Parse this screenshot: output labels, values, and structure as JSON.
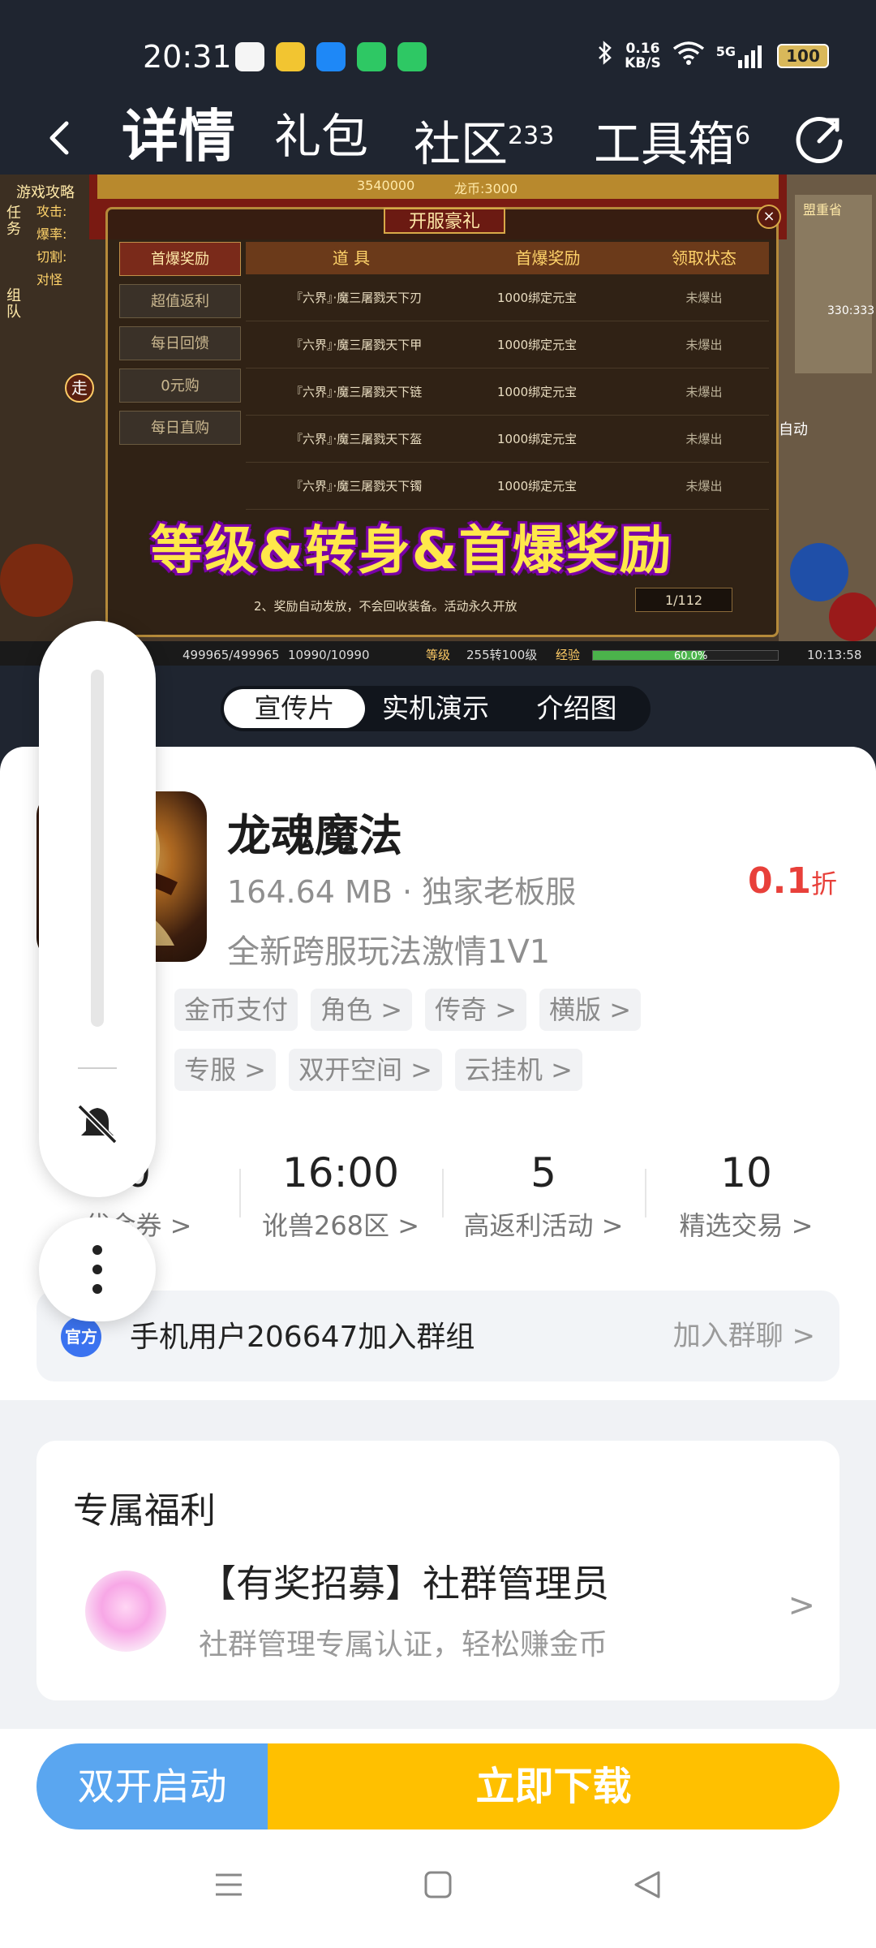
{
  "status_bar": {
    "time": "20:31",
    "net_speed_value": "0.16",
    "net_speed_unit": "KB/S",
    "signal_label": "5G",
    "battery": "100",
    "app_colors": [
      "#f5f5f5",
      "#f2c531",
      "#1e88f7",
      "#2ec864",
      "#2ec864"
    ]
  },
  "nav": {
    "back_icon": "chevron-left-icon",
    "tabs": [
      {
        "label": "详情",
        "badge": ""
      },
      {
        "label": "礼包",
        "badge": ""
      },
      {
        "label": "社区",
        "badge": "233"
      },
      {
        "label": "工具箱",
        "badge": "6"
      }
    ],
    "refresh_icon": "share-refresh-icon"
  },
  "banner": {
    "panel_title": "开服豪礼",
    "left_menu": [
      "首爆奖励",
      "超值返利",
      "每日回馈",
      "0元购",
      "每日直购"
    ],
    "table_headers": [
      "道 具",
      "首爆奖励",
      "领取状态"
    ],
    "rows": [
      {
        "item": "『六界』·魔三屠戮天下刃",
        "reward": "1000绑定元宝",
        "status": "未爆出"
      },
      {
        "item": "『六界』·魔三屠戮天下甲",
        "reward": "1000绑定元宝",
        "status": "未爆出"
      },
      {
        "item": "『六界』·魔三屠戮天下链",
        "reward": "1000绑定元宝",
        "status": "未爆出"
      },
      {
        "item": "『六界』·魔三屠戮天下盔",
        "reward": "1000绑定元宝",
        "status": "未爆出"
      },
      {
        "item": "『六界』·魔三屠戮天下镯",
        "reward": "1000绑定元宝",
        "status": "未爆出"
      }
    ],
    "note": "2、奖励自动发放，不会回收装备。活动永久开放",
    "pager": "1/112",
    "overlay_text": "等级&转身&首爆奖励",
    "hud_hp": "499965/499965",
    "hud_mp": "10990/10990",
    "hud_level_label": "等级",
    "hud_level": "255转100级",
    "hud_exp_label": "经验",
    "hud_exp": "60.0%",
    "hud_time": "10:13:58",
    "top_left_label": "游戏攻略",
    "map_label": "盟重省",
    "map_coords": "330:333",
    "gold": "3540000",
    "coin_label": "龙币",
    "coin_value": "3000",
    "side_tabs": [
      "任务",
      "组队"
    ],
    "side_menu": [
      "攻击:",
      "爆率:",
      "切割:",
      "对怪"
    ],
    "walk_label": "走",
    "auto_label": "自动"
  },
  "media_tabs": [
    {
      "label": "宣传片",
      "active": true
    },
    {
      "label": "实机演示",
      "active": false
    },
    {
      "label": "介绍图",
      "active": false
    }
  ],
  "game": {
    "name": "龙魂魔法",
    "meta": "164.64 MB · 独家老板服",
    "desc": "全新跨服玩法激情1V1",
    "discount_value": "0.1",
    "discount_unit": "折",
    "tags": [
      "金币支付",
      "角色 >",
      "传奇 >",
      "横版 >",
      "专服 >",
      "双开空间 >",
      "云挂机 >"
    ]
  },
  "stats": [
    {
      "value": "0",
      "label": "代金券 >"
    },
    {
      "value": "16:00",
      "label": "讹兽268区 >"
    },
    {
      "value": "5",
      "label": "高返利活动 >"
    },
    {
      "value": "10",
      "label": "精选交易 >"
    }
  ],
  "group": {
    "badge": "官方",
    "text": "手机用户206647加入群组",
    "join": "加入群聊 >"
  },
  "welfare": {
    "title": "专属福利",
    "item_title": "【有奖招募】社群管理员",
    "item_sub": "社群管理专属认证，轻松赚金币",
    "arrow": ">"
  },
  "actions": {
    "dual_launch": "双开启动",
    "download": "立即下载"
  }
}
